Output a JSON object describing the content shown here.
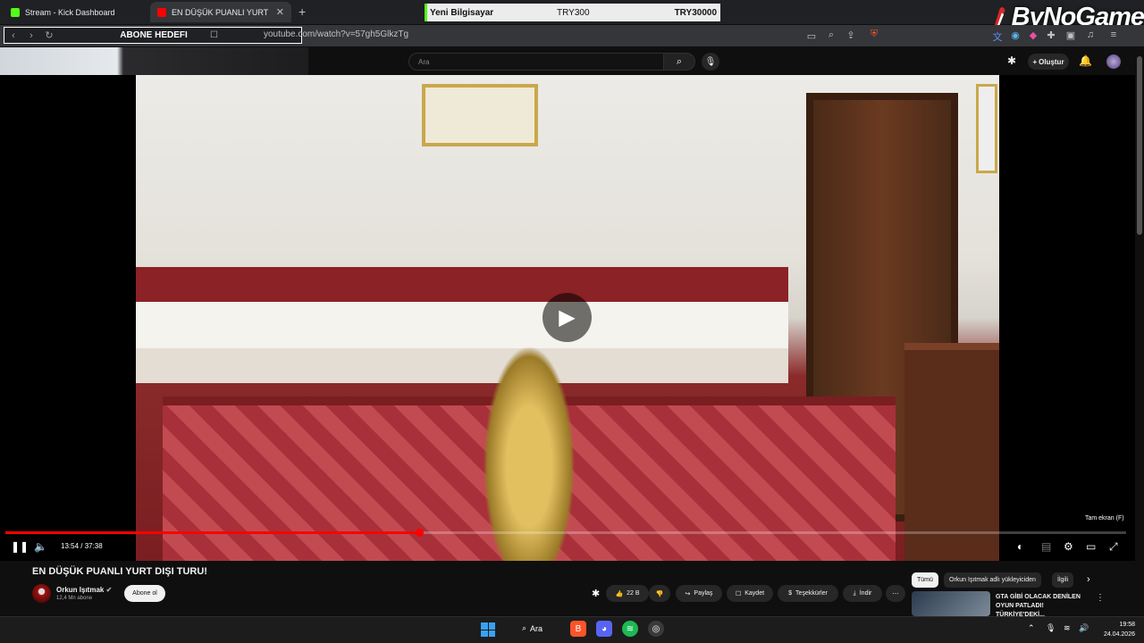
{
  "browser": {
    "tabs": [
      {
        "label": "Stream - Kick Dashboard",
        "favicon_color": "#53fc18"
      },
      {
        "label": "EN DÜŞÜK PUANLI YURT DIŞI TU",
        "favicon_color": "#ff0000"
      }
    ],
    "new_tab": "+",
    "url": "youtube.com/watch?v=57gh5GlkzTg"
  },
  "goal_widget": {
    "label": "Yeni Bilgisayar",
    "current": "TRY300",
    "target": "TRY30000"
  },
  "overlay": {
    "brand": "ByNoGame",
    "goal_title": "ABONE HEDEFI"
  },
  "youtube": {
    "search_placeholder": "Ara",
    "create_label": "Oluştur",
    "fullscreen_tip": "Tam ekran (F)",
    "time_display": "13:54 / 37:38",
    "progress": 0.369,
    "video_title": "EN DÜŞÜK PUANLI YURT DIŞI TURU!",
    "channel": {
      "name": "Orkun Işıtmak",
      "subs": "12,4 Mn abone",
      "subscribe": "Abone ol"
    },
    "actions": {
      "likes": "22 B",
      "share": "Paylaş",
      "save": "Kaydet",
      "thanks": "Teşekkürler",
      "download": "İndir"
    },
    "chips": [
      "Tümü",
      "Orkun Işıtmak adlı yükleyiciden",
      "İlgili"
    ],
    "recommendation": {
      "title": "GTA GİBİ OLACAK DENİLEN OYUN PATLADI! TÜRKİYE'DEKİ..."
    }
  },
  "taskbar": {
    "search": "Ara",
    "time": "19:58",
    "date": "24.04.2026"
  }
}
